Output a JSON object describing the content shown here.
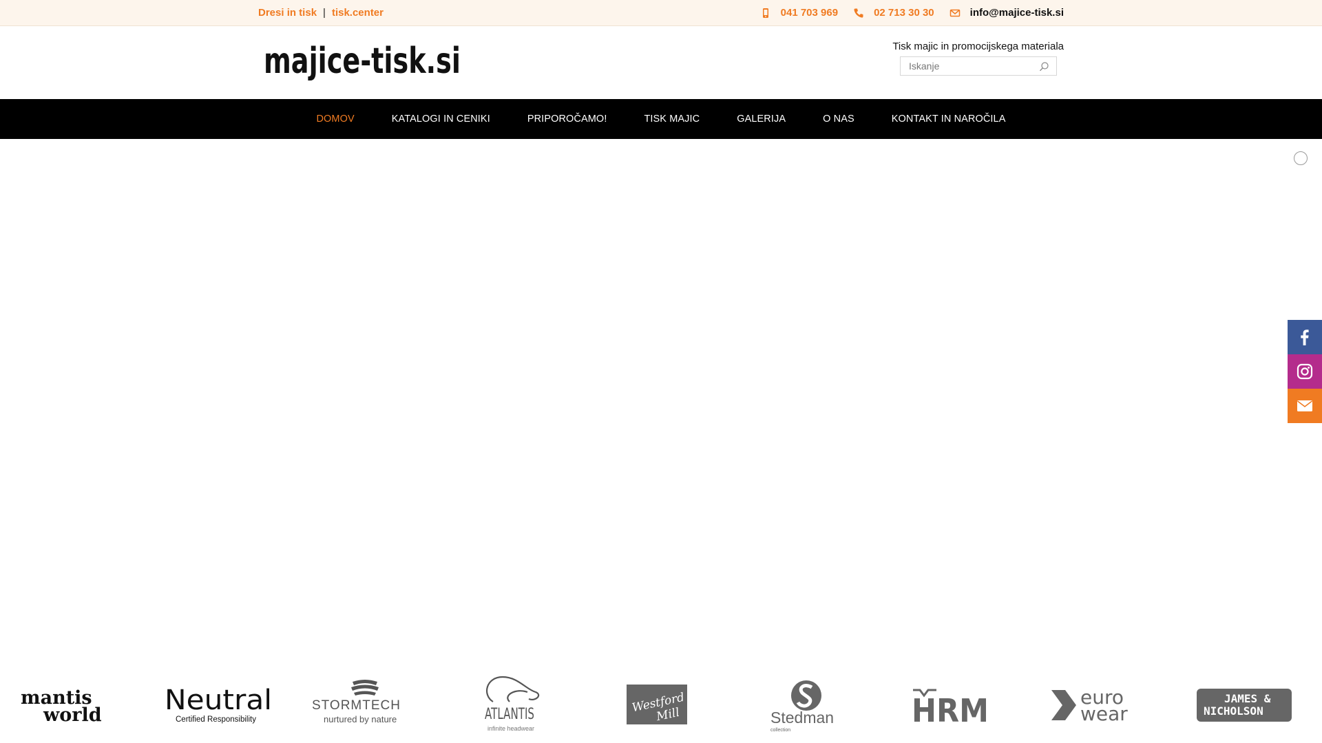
{
  "topbar": {
    "links": [
      "Dresi in tisk",
      "tisk.center"
    ],
    "separator": "|",
    "mobile": "041 703 969",
    "phone": "02 713 30 30",
    "email": "info@majice-tisk.si"
  },
  "header": {
    "logo_text": "majice-tisk.si",
    "tagline": "Tisk majic in promocijskega materiala",
    "search_placeholder": "Iskanje"
  },
  "nav": {
    "items": [
      "DOMOV",
      "KATALOGI IN CENIKI",
      "PRIPOROČAMO!",
      "TISK MAJIC",
      "GALERIJA",
      "O NAS",
      "KONTAKT IN NAROČILA"
    ],
    "active": "DOMOV"
  },
  "brands": [
    {
      "line1": "mantis",
      "line2": "world"
    },
    {
      "line1": "Neutral",
      "line2": "Certified Responsibility"
    },
    {
      "line1": "STORMTECH",
      "line2": "nurtured by nature"
    },
    {
      "line1": "ATLANTIS",
      "line2": "infinite headwear"
    },
    {
      "line1": "Westford",
      "line2": "Mill"
    },
    {
      "line1": "Stedman",
      "line2": "collection"
    },
    {
      "line1": "HRM",
      "line2": ""
    },
    {
      "line1": "euro",
      "line2": "wear"
    },
    {
      "line1": "JAMES &",
      "line2": "NICHOLSON"
    }
  ],
  "colors": {
    "accent": "#f07b22",
    "topbar_bg": "#fdf5ec",
    "nav_bg": "#000000",
    "facebook": "#3b5998",
    "instagram": "#b42c8c",
    "mail": "#f07b22"
  },
  "icons": {
    "mobile": "mobile-icon",
    "phone": "phone-icon",
    "email": "envelope-icon",
    "search": "search-icon",
    "facebook": "facebook-icon",
    "instagram": "instagram-icon",
    "mail": "mail-icon"
  }
}
